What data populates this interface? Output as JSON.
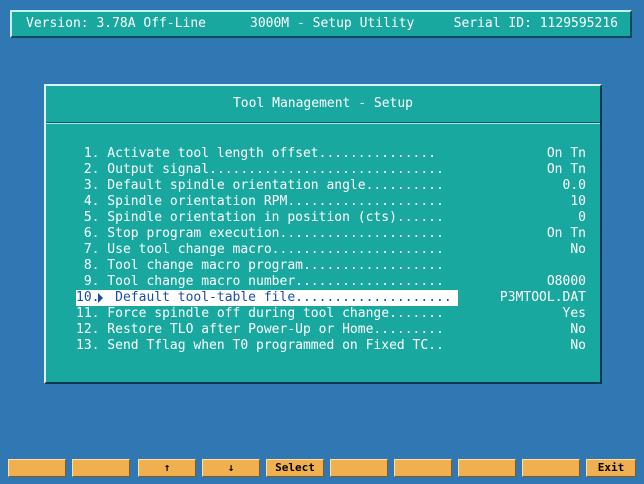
{
  "header": {
    "version": "Version: 3.78A Off-Line",
    "title": "3000M - Setup Utility",
    "serial": "Serial ID: 1129595216"
  },
  "panel": {
    "title": "Tool Management - Setup",
    "items": [
      {
        "label": " 1. Activate tool length offset...............",
        "value": "On Tn"
      },
      {
        "label": " 2. Output signal..............................",
        "value": "On Tn"
      },
      {
        "label": " 3. Default spindle orientation angle..........",
        "value": "0.0"
      },
      {
        "label": " 4. Spindle orientation RPM....................",
        "value": "10"
      },
      {
        "label": " 5. Spindle orientation in position (cts)......",
        "value": "0"
      },
      {
        "label": " 6. Stop program execution.....................",
        "value": "On Tn"
      },
      {
        "label": " 7. Use tool change macro......................",
        "value": "No"
      },
      {
        "label": " 8. Tool change macro program..................",
        "value": ""
      },
      {
        "label": " 9. Tool change macro number...................",
        "value": "O8000"
      },
      {
        "label": "10.  Default tool-table file....................",
        "value": "P3MTOOL.DAT"
      },
      {
        "label": "11. Force spindle off during tool change.......",
        "value": "Yes"
      },
      {
        "label": "12. Restore TLO after Power-Up or Home.........",
        "value": "No"
      },
      {
        "label": "13. Send Tflag when T0 programmed on Fixed TC..",
        "value": "No"
      }
    ],
    "selected_index": 9
  },
  "function_keys": [
    "",
    "",
    "↑",
    "↓",
    "Select",
    "",
    "",
    "",
    "",
    "Exit"
  ],
  "colors": {
    "background": "#2f78b4",
    "panel": "#18a8a0",
    "function_key": "#f0b050",
    "selection": "#ffffff",
    "selection_text": "#1a4fa0"
  }
}
